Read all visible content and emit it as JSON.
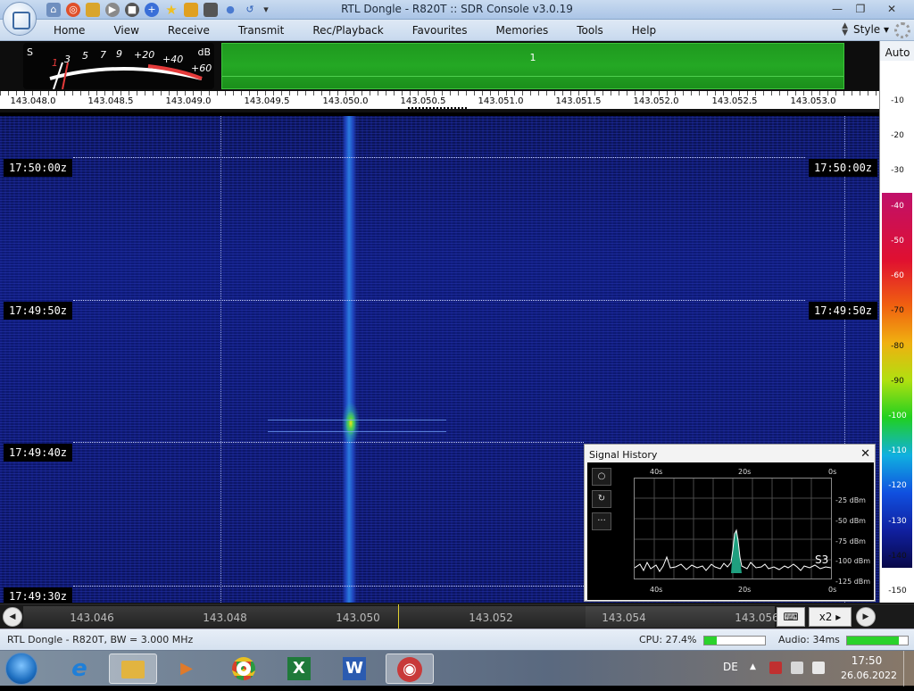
{
  "window": {
    "title": "RTL Dongle - R820T :: SDR Console v3.0.19",
    "minimize": "—",
    "maximize": "❐",
    "close": "✕"
  },
  "quick_access": [
    "home-icon",
    "lifebuoy-icon",
    "folder-icon",
    "play-icon",
    "stop-icon",
    "plus-icon",
    "star-icon",
    "lock-icon",
    "camera-icon",
    "drop-icon",
    "undo-icon",
    "dropdown-icon"
  ],
  "menu": {
    "items": [
      "Home",
      "View",
      "Receive",
      "Transmit",
      "Rec/Playback",
      "Favourites",
      "Memories",
      "Tools",
      "Help"
    ],
    "style_label": "Style"
  },
  "smeter": {
    "s_label": "S",
    "db_label": "dB",
    "scale": [
      "1",
      "3",
      "5",
      "7",
      "9",
      "+20",
      "+40",
      "+60"
    ]
  },
  "band_bar": {
    "label": "1"
  },
  "ruler": {
    "labels": [
      "143.048.0",
      "143.048.5",
      "143.049.0",
      "143.049.5",
      "143.050.0",
      "143.050.5",
      "143.051.0",
      "143.051.5",
      "143.052.0",
      "143.052.5",
      "143.053.0"
    ]
  },
  "waterfall": {
    "times": [
      "17:50:00z",
      "17:49:50z",
      "17:49:40z",
      "17:49:30z"
    ]
  },
  "db_scale": {
    "auto_label": "Auto",
    "ticks": [
      "-10",
      "-20",
      "-30",
      "-40",
      "-50",
      "-60",
      "-70",
      "-80",
      "-90",
      "-100",
      "-110",
      "-120",
      "-130",
      "-140",
      "-150"
    ]
  },
  "signal_history": {
    "title": "Signal History",
    "close": "✕",
    "top_axis": [
      "40s",
      "20s",
      "0s"
    ],
    "bottom_axis": [
      "40s",
      "20s",
      "0s"
    ],
    "y_axis": [
      "-25 dBm",
      "-50 dBm",
      "-75 dBm",
      "-100 dBm",
      "-125 dBm"
    ],
    "s_reading": "S3",
    "buttons": [
      "○",
      "↻",
      "···"
    ]
  },
  "tuner": {
    "labels": [
      "143.046",
      "143.048",
      "143.050",
      "143.052",
      "143.054",
      "143.056"
    ],
    "zoom_label": "x2",
    "left_btn": "◀",
    "right_btn": "▶",
    "keyboard_icon": "⌨",
    "arrow": "▸"
  },
  "status": {
    "device": "RTL Dongle - R820T, BW = 3.000 MHz",
    "cpu": "CPU: 27.4%",
    "cpu_level": 0.2,
    "audio": "Audio: 34ms",
    "audio_level": 0.85
  },
  "taskbar": {
    "apps": [
      {
        "name": "internet-explorer",
        "glyph": "e",
        "color": "#1f7fd8"
      },
      {
        "name": "file-explorer",
        "glyph": "",
        "color": "#e2b440"
      },
      {
        "name": "media-player",
        "glyph": "▶",
        "color": "#e07a2a"
      },
      {
        "name": "chrome",
        "glyph": "",
        "color": "#d8402a"
      },
      {
        "name": "excel",
        "glyph": "X",
        "color": "#1f7a3a"
      },
      {
        "name": "word",
        "glyph": "W",
        "color": "#2b5bb0"
      },
      {
        "name": "sdr-console",
        "glyph": "◉",
        "color": "#c83a3a"
      }
    ],
    "lang": "DE",
    "time": "17:50",
    "date": "26.06.2022"
  }
}
